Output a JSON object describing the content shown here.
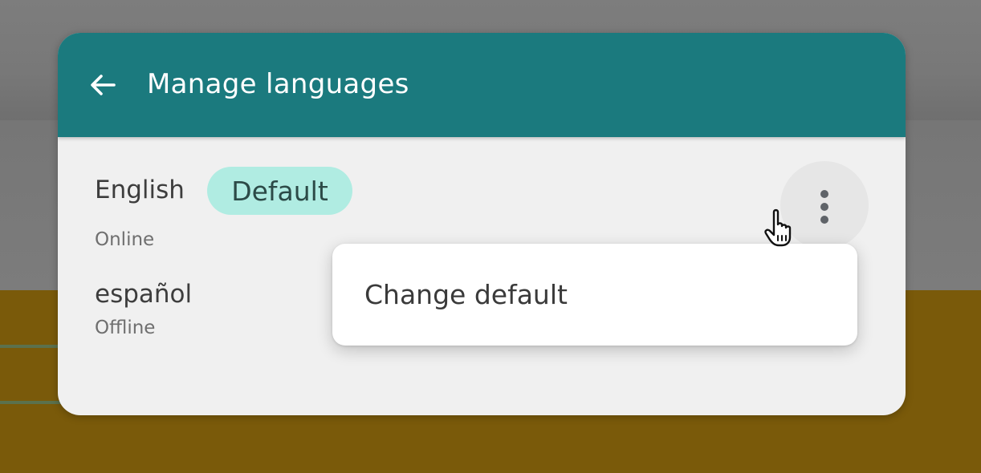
{
  "appbar": {
    "title": "Manage languages",
    "back_icon": "arrow-left-icon"
  },
  "languages": [
    {
      "name": "English",
      "status": "Online",
      "badge": "Default"
    },
    {
      "name": "español",
      "status": "Offline"
    }
  ],
  "more_menu": {
    "icon": "more-vert-icon",
    "items": [
      {
        "label": "Change default"
      }
    ]
  },
  "colors": {
    "appbar": "#1b7a7e",
    "chip": "#b0ece2",
    "card": "#f0f0f0"
  }
}
